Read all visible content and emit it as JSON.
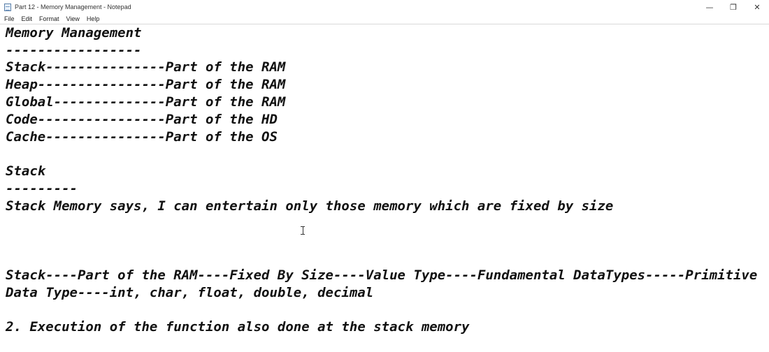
{
  "window": {
    "title": "Part 12 - Memory Management - Notepad",
    "icon": "notepad-icon",
    "controls": {
      "minimize": "—",
      "restore": "❐",
      "close": "✕"
    }
  },
  "menu": [
    "File",
    "Edit",
    "Format",
    "View",
    "Help"
  ],
  "editor": {
    "lines": [
      "Memory Management",
      "-----------------",
      "Stack---------------Part of the RAM",
      "Heap----------------Part of the RAM",
      "Global--------------Part of the RAM",
      "Code----------------Part of the HD",
      "Cache---------------Part of the OS",
      "",
      "Stack",
      "---------",
      "Stack Memory says, I can entertain only those memory which are fixed by size",
      "",
      "",
      "",
      "Stack----Part of the RAM----Fixed By Size----Value Type----Fundamental DataTypes-----Primitive",
      "Data Type----int, char, float, double, decimal",
      "",
      "2. Execution of the function also done at the stack memory"
    ]
  }
}
